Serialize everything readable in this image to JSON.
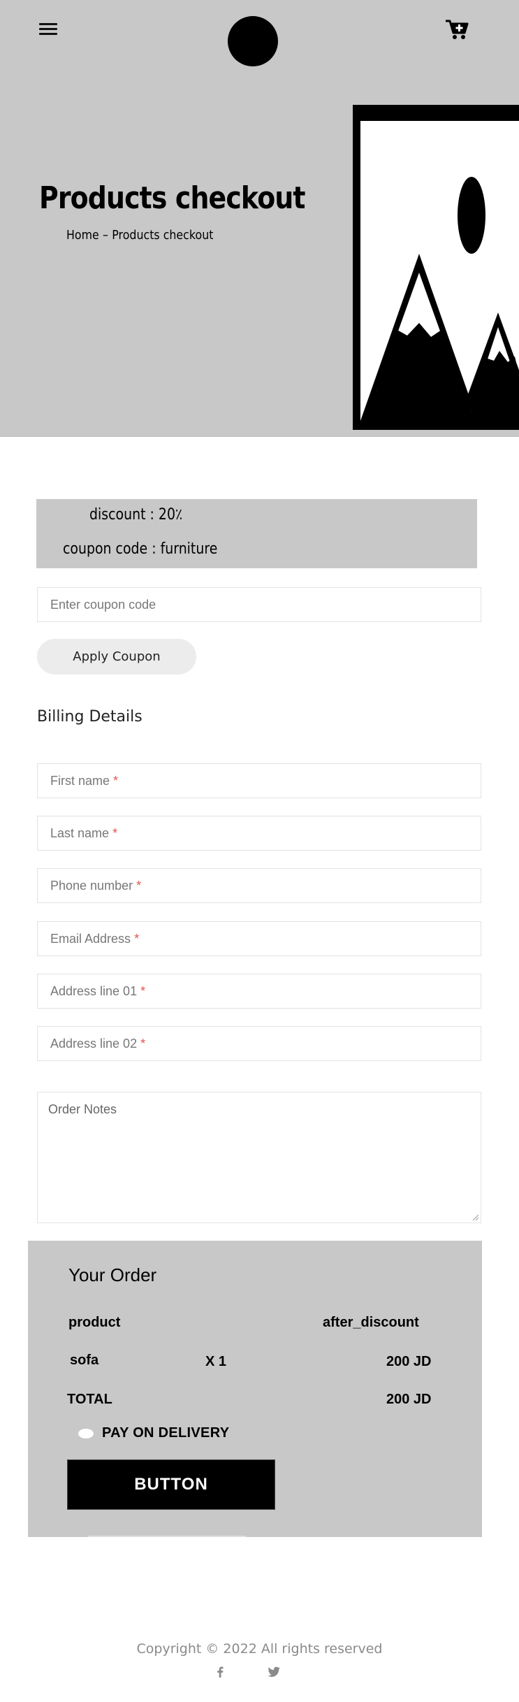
{
  "header": {
    "menu_icon": "hamburger-menu-icon",
    "logo_icon": "logo-circle",
    "cart_icon": "cart-plus-icon"
  },
  "hero": {
    "title": "Products checkout",
    "breadcrumb": {
      "home": "Home",
      "separator": "–",
      "current": "Products checkout"
    },
    "image_icon": "image-placeholder-icon"
  },
  "discount": {
    "line1": "discount : 20٪",
    "line2": "coupon code : furniture"
  },
  "coupon": {
    "placeholder": "Enter coupon code",
    "apply_label": "Apply Coupon"
  },
  "billing": {
    "title": "Billing Details",
    "fields": [
      {
        "label": "First name",
        "required": "*"
      },
      {
        "label": "Last name",
        "required": "*"
      },
      {
        "label": "Phone number",
        "required": "*"
      },
      {
        "label": "Email Address",
        "required": "*"
      },
      {
        "label": "Address line 01",
        "required": "*"
      },
      {
        "label": "Address line 02",
        "required": "*"
      }
    ],
    "notes_placeholder": "Order Notes"
  },
  "order": {
    "title": "Your Order",
    "col_product": "product",
    "col_after": "after_discount",
    "items": [
      {
        "name": "sofa",
        "qty": "X 1",
        "price": "200 JD"
      }
    ],
    "total_label": "TOTAL",
    "total_value": "200 JD",
    "payment_label": "PAY ON DELIVERY",
    "button_label": "BUTTON"
  },
  "footer": {
    "copyright": "Copyright © 2022 All rights reserved",
    "social": [
      "facebook-icon",
      "twitter-icon"
    ]
  },
  "colors": {
    "hero_bg": "#c8c8c8",
    "required": "#e2564f",
    "button_bg": "#000000",
    "footer_text": "#8a8a8a"
  }
}
